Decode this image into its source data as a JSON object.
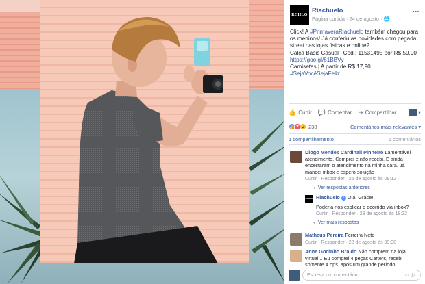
{
  "post": {
    "page_name": "Riachuelo",
    "logo_text": "RCHLO",
    "meta": "Página curtida · 24 de agosto · ",
    "globe_icon": "globe-icon",
    "more_icon": "ellipsis-icon",
    "text_line1_start": "Click! A ",
    "hashtag1": "#PrimaveraRiachuelo",
    "text_line1_end": " também chegou para os meninos! Já conferiu as novidades com pegada street nas lojas físicas e online?",
    "product_line": "Calça Basic Casual | Cód.: 11531495 por R$ 59,90",
    "product_link": "https://goo.gl/61BBVy",
    "shirts_line": "Camisetas | A partir de R$ 17,90",
    "hashtag2": "#SejaVocêSejaFeliz"
  },
  "actions": {
    "like": "Curtir",
    "comment": "Comentar",
    "share": "Compartilhar"
  },
  "reactions": {
    "count": "238",
    "sort_label": "Comentários mais relevantes",
    "shares": "1 compartilhamento",
    "comments": "6 comentários"
  },
  "comments": [
    {
      "name": "Diogo Mendes Cardinali Pinheiro",
      "text": " Lamentável atendimento. Comprei e não recebi. E ainda encerraram o atendimento na minha cara. Já mandei inbox e espero solução",
      "actions": "Curtir · Responder · 25 de agosto às 09:12",
      "more_replies": "Ver respostas anteriores"
    },
    {
      "name": "Matheus Pereira",
      "text": " Ferreira Neto",
      "actions": "Curtir · Responder · 28 de agosto às 09:38"
    },
    {
      "name": "Anne Godinho Braido",
      "text": " Não comprem na loja virtual... Eu comprei 4 peças Carters, recebi somente 4 ops. após um grande período"
    }
  ],
  "reply": {
    "name": "Riachuelo",
    "greeting": " Olá, Grace!",
    "text": "Poderia nos explicar o ocorrido via inbox?",
    "actions": "Curtir · Responder · 28 de agosto às 18:22",
    "more_replies": "Ver mais respostas"
  },
  "write_comment": {
    "placeholder": "Escreva um comentário..."
  },
  "colors": {
    "link": "#365899",
    "meta": "#90949c",
    "panel_pink": "#f6c9b8"
  }
}
